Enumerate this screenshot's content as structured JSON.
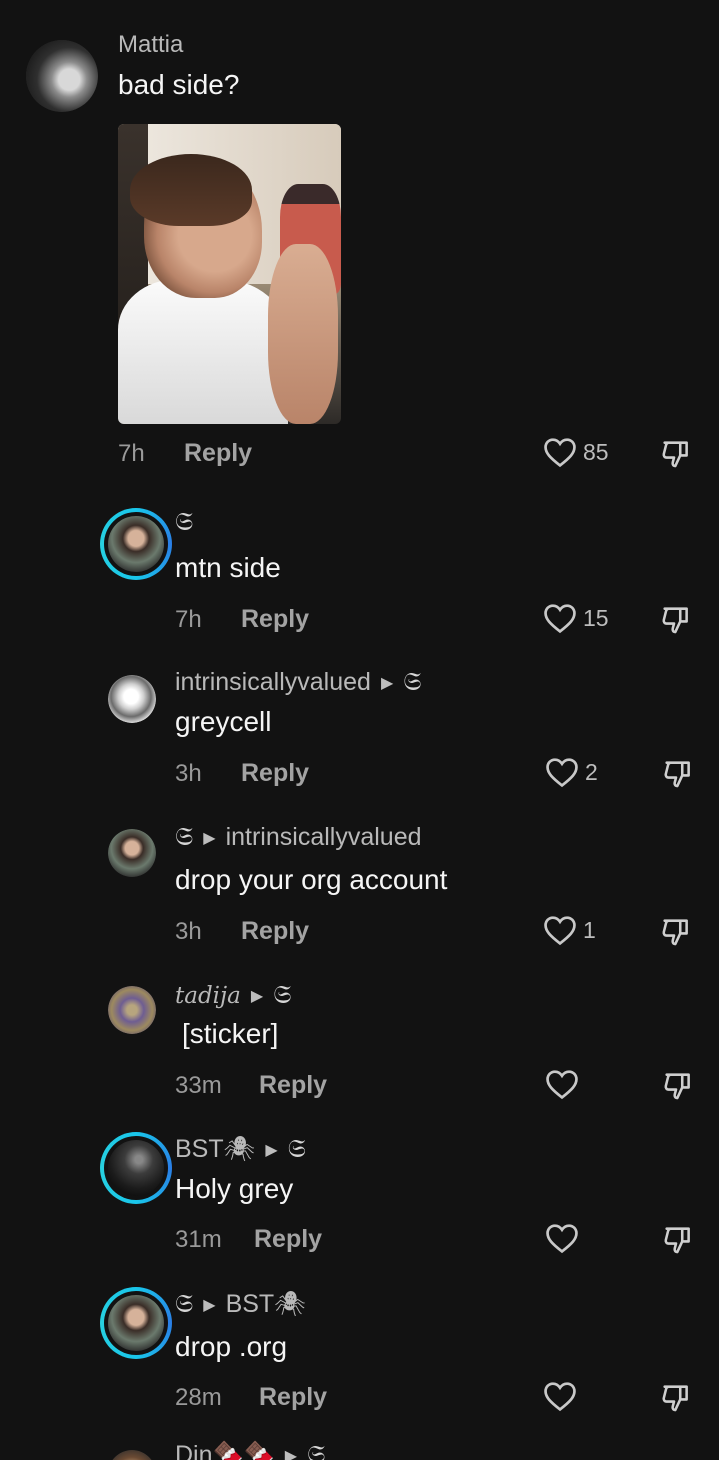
{
  "comments": [
    {
      "user": "Mattia",
      "text": "bad side?",
      "time": "7h",
      "reply": "Reply",
      "likes": "85",
      "has_image": true
    },
    {
      "user": "𝔖",
      "text": "mtn side",
      "time": "7h",
      "reply": "Reply",
      "likes": "15"
    },
    {
      "user": "intrinsicallyvalued",
      "reply_to": "𝔖",
      "text": "greycell",
      "time": "3h",
      "reply": "Reply",
      "likes": "2"
    },
    {
      "user": "𝔖",
      "reply_to": "intrinsicallyvalued",
      "text": "drop your org account",
      "time": "3h",
      "reply": "Reply",
      "likes": "1"
    },
    {
      "user": "tadija",
      "reply_to": "𝔖",
      "text": "[sticker]",
      "time": "33m",
      "reply": "Reply",
      "likes": ""
    },
    {
      "user": "BST🕷",
      "reply_to": "𝔖",
      "text": "Holy grey",
      "time": "31m",
      "reply": "Reply",
      "likes": ""
    },
    {
      "user": "𝔖",
      "reply_to": "BST🕷",
      "text": "drop .org",
      "time": "28m",
      "reply": "Reply",
      "likes": ""
    },
    {
      "user": "Din🍫🍫",
      "reply_to": "𝔖"
    }
  ],
  "icons": {
    "like": "heart-outline-icon",
    "dislike": "thumbs-down-icon",
    "reply_arrow": "triangle-right-icon"
  },
  "colors": {
    "background": "#121212",
    "ring": "#19c6ea"
  }
}
